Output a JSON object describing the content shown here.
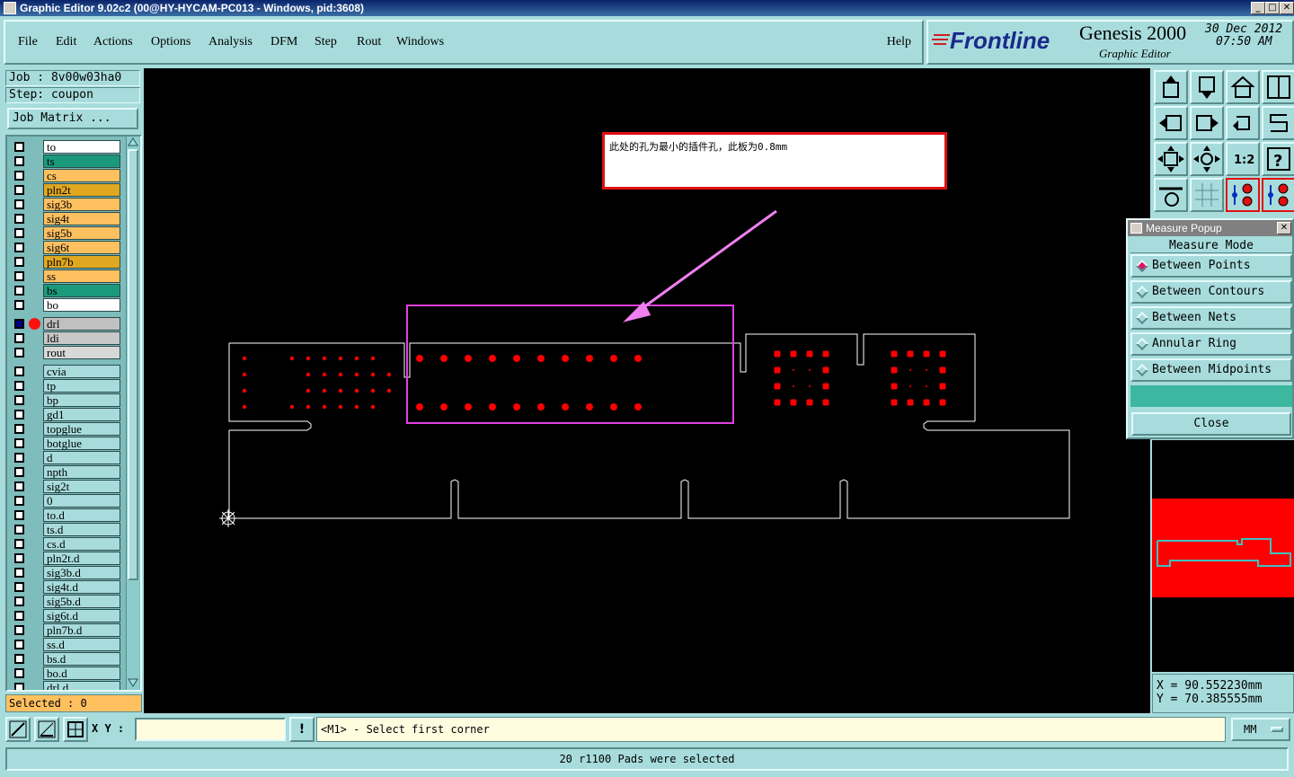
{
  "window": {
    "title": "Graphic Editor 9.02c2 (00@HY-HYCAM-PC013 - Windows, pid:3608)",
    "controls": [
      "_",
      "□",
      "✕"
    ]
  },
  "menu": {
    "items": [
      "File",
      "Edit",
      "Actions",
      "Options",
      "Analysis",
      "DFM",
      "Step",
      "Rout",
      "Windows"
    ],
    "help": "Help"
  },
  "logo": {
    "brand": "Frontline",
    "product": "Genesis 2000",
    "subtitle": "Graphic Editor",
    "date": "30 Dec 2012",
    "time": "07:50 AM"
  },
  "job": {
    "job_label": "Job : 8v00w03ha0",
    "step_label": "Step: coupon",
    "matrix_button": "Job Matrix ..."
  },
  "layers": [
    {
      "name": "to",
      "color": "#ffffff"
    },
    {
      "name": "ts",
      "color": "#1a9a7a"
    },
    {
      "name": "cs",
      "color": "#ffc060"
    },
    {
      "name": "pln2t",
      "color": "#e0a820"
    },
    {
      "name": "sig3b",
      "color": "#ffc060"
    },
    {
      "name": "sig4t",
      "color": "#ffc060"
    },
    {
      "name": "sig5b",
      "color": "#ffc060"
    },
    {
      "name": "sig6t",
      "color": "#ffc060"
    },
    {
      "name": "pln7b",
      "color": "#e0a820"
    },
    {
      "name": "ss",
      "color": "#ffc060"
    },
    {
      "name": "bs",
      "color": "#1a9a7a"
    },
    {
      "name": "bo",
      "color": "#ffffff"
    }
  ],
  "drill_layers": [
    {
      "name": "drl",
      "color": "#c0c0c0",
      "active": true
    },
    {
      "name": "ldi",
      "color": "#c8c8c8",
      "active": false
    },
    {
      "name": "rout",
      "color": "#d8d8d8",
      "active": false
    }
  ],
  "misc_layers": [
    "cvia",
    "tp",
    "bp",
    "gd1",
    "topglue",
    "botglue",
    "d",
    "npth",
    "sig2t",
    "0",
    "to.d",
    "ts.d",
    "cs.d",
    "pln2t.d",
    "sig3b.d",
    "sig4t.d",
    "sig5b.d",
    "sig6t.d",
    "pln7b.d",
    "ss.d",
    "bs.d",
    "bo.d",
    "drl.d"
  ],
  "selected_label": "Selected : 0",
  "annotation": {
    "text": "此处的孔为最小的插件孔，此板为0.8mm"
  },
  "measure_popup": {
    "title": "Measure Popup",
    "header": "Measure Mode",
    "options": [
      "Between Points",
      "Between Contours",
      "Between Nets",
      "Annular Ring",
      "Between Midpoints"
    ],
    "selected": "Between Points",
    "close": "Close"
  },
  "coords": {
    "x": "X = 90.552230mm",
    "y": "Y = 70.385555mm"
  },
  "bottom": {
    "xy_label": "X Y :",
    "xy_value": "",
    "prompt": "<M1> - Select first corner",
    "units": "MM",
    "status": "20 r1100 Pads were selected"
  },
  "colors": {
    "panel": "#a8dcdc",
    "canvas": "#000000",
    "pad": "#ff0000",
    "selection": "#e040e0",
    "arrow": "#f080f0",
    "profile": "#ffffff"
  }
}
